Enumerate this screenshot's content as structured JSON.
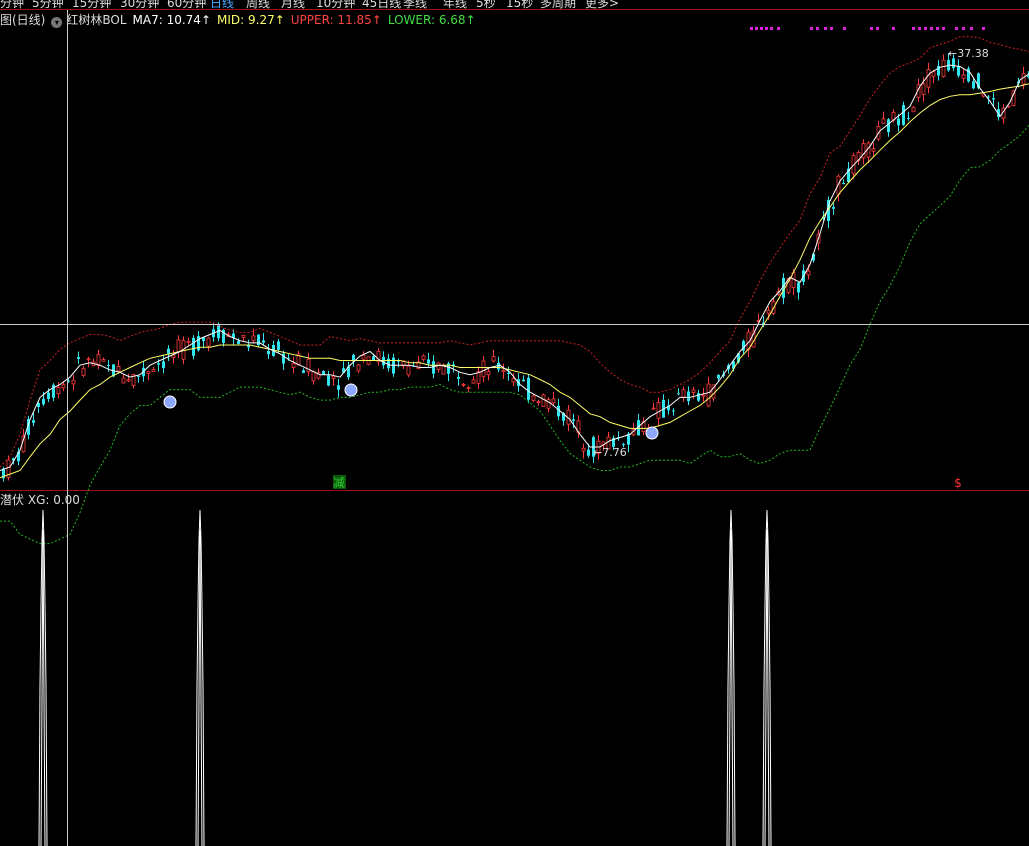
{
  "period_tabs": [
    {
      "label": "分钟",
      "active": false
    },
    {
      "label": "5分钟",
      "active": false
    },
    {
      "label": "15分钟",
      "active": false
    },
    {
      "label": "30分钟",
      "active": false
    },
    {
      "label": "60分钟",
      "active": false
    },
    {
      "label": "日线",
      "active": true
    },
    {
      "label": "周线",
      "active": false
    },
    {
      "label": "月线",
      "active": false
    },
    {
      "label": "10分钟",
      "active": false
    },
    {
      "label": "45日线",
      "active": false
    },
    {
      "label": "季线",
      "active": false
    },
    {
      "label": "年线",
      "active": false
    },
    {
      "label": "5秒",
      "active": false
    },
    {
      "label": "15秒",
      "active": false
    },
    {
      "label": "多周期",
      "active": false
    },
    {
      "label": "更多>",
      "active": false
    }
  ],
  "main_legend": {
    "panel_title": "图(日线)",
    "indicator_name": "红树林BOL",
    "ma7": "MA7: 10.74↑",
    "mid": "MID: 9.27↑",
    "upper": "UPPER: 11.85↑",
    "lower": "LOWER: 6.68↑",
    "colors": {
      "ma7": "#ffffff",
      "mid": "#ffff66",
      "upper": "#ff4444",
      "lower": "#44dd44"
    }
  },
  "sub_legend": {
    "name": "潜伏",
    "value": "XG: 0.00"
  },
  "chart_data": {
    "type": "line",
    "panels": [
      {
        "name": "price",
        "indicator": "红树林BOL",
        "x": [
          0,
          10,
          20,
          30,
          40,
          50,
          60,
          70,
          80,
          90,
          100,
          110,
          120,
          130,
          140,
          150,
          160,
          170,
          180,
          190,
          200,
          210,
          220,
          230,
          240,
          250,
          260,
          270,
          280,
          290,
          300,
          310,
          320,
          330,
          340,
          350,
          360,
          370,
          380,
          390,
          400,
          410,
          420,
          430,
          440,
          450,
          460,
          470,
          480,
          490,
          500,
          510,
          520,
          530,
          540,
          550,
          560,
          570,
          580,
          590,
          600,
          610,
          620,
          630,
          640,
          650,
          660,
          670,
          680,
          690,
          700,
          710,
          720,
          730,
          740,
          750,
          760,
          770,
          780,
          790,
          800,
          810,
          820,
          830,
          840,
          850,
          860,
          870,
          880,
          890,
          900,
          910,
          920,
          930,
          940,
          950,
          960,
          970,
          980,
          990,
          1000,
          1010,
          1020,
          1029
        ],
        "ma7": [
          7.2,
          7.3,
          7.8,
          8.8,
          9.6,
          9.9,
          10.1,
          10.4,
          10.9,
          11.0,
          10.9,
          10.7,
          10.6,
          10.4,
          10.5,
          10.9,
          11.1,
          11.3,
          11.5,
          11.8,
          12.1,
          12.3,
          12.5,
          12.2,
          12.0,
          11.9,
          11.9,
          11.6,
          11.4,
          11.1,
          10.9,
          10.7,
          10.5,
          10.5,
          10.4,
          10.9,
          11.3,
          11.5,
          11.1,
          10.9,
          10.9,
          10.9,
          10.8,
          10.8,
          10.9,
          10.8,
          10.6,
          10.5,
          10.6,
          10.8,
          10.9,
          10.6,
          10.1,
          9.8,
          9.6,
          9.4,
          9.1,
          8.8,
          8.3,
          7.9,
          7.9,
          8.1,
          8.2,
          8.3,
          8.6,
          8.9,
          9.1,
          9.3,
          9.6,
          9.6,
          9.7,
          9.8,
          10.3,
          10.9,
          11.5,
          12.0,
          13.0,
          14.0,
          14.6,
          15.4,
          15.1,
          16.2,
          18.3,
          20.8,
          22.5,
          23.6,
          24.6,
          25.8,
          27.4,
          28.3,
          29.2,
          30.2,
          32.7,
          34.4,
          35.2,
          35.5,
          35.3,
          34.5,
          32.4,
          30.8,
          29.0,
          30.7,
          33.5,
          34.3
        ],
        "mid": [
          7.0,
          7.1,
          7.2,
          7.6,
          8.0,
          8.3,
          8.8,
          9.1,
          9.5,
          9.9,
          10.1,
          10.4,
          10.6,
          10.8,
          11.0,
          11.2,
          11.3,
          11.4,
          11.5,
          11.6,
          11.7,
          11.7,
          11.8,
          11.8,
          11.8,
          11.8,
          11.7,
          11.6,
          11.5,
          11.4,
          11.3,
          11.2,
          11.2,
          11.2,
          11.1,
          11.1,
          11.1,
          11.1,
          11.1,
          11.1,
          11.1,
          11.0,
          11.0,
          10.9,
          10.9,
          10.9,
          10.8,
          10.8,
          10.8,
          10.8,
          10.8,
          10.7,
          10.6,
          10.5,
          10.3,
          10.1,
          9.8,
          9.6,
          9.3,
          9.0,
          8.9,
          8.7,
          8.6,
          8.5,
          8.5,
          8.5,
          8.6,
          8.7,
          8.9,
          9.1,
          9.3,
          9.6,
          10.0,
          10.5,
          11.2,
          11.7,
          12.5,
          13.3,
          14.3,
          15.3,
          16.5,
          18.0,
          19.2,
          20.3,
          21.5,
          22.5,
          23.5,
          24.4,
          25.4,
          26.4,
          27.3,
          28.4,
          29.4,
          30.3,
          31.0,
          31.4,
          31.6,
          31.6,
          31.8,
          32.0,
          32.3,
          32.5,
          32.7,
          33.0
        ],
        "upper": [
          7.3,
          7.6,
          8.3,
          9.5,
          10.7,
          11.1,
          11.6,
          11.9,
          12.1,
          12.3,
          12.3,
          12.2,
          12.0,
          12.2,
          12.4,
          12.5,
          12.6,
          12.8,
          12.9,
          12.9,
          12.9,
          12.9,
          12.7,
          12.5,
          12.4,
          12.4,
          12.6,
          12.4,
          12.2,
          12.0,
          11.8,
          11.8,
          11.8,
          12.2,
          12.1,
          12.0,
          12.1,
          12.0,
          11.9,
          11.9,
          11.9,
          11.9,
          11.9,
          11.9,
          11.9,
          12.0,
          11.9,
          11.8,
          11.9,
          12.0,
          12.0,
          12.0,
          12.0,
          12.0,
          12.0,
          12.0,
          12.0,
          11.9,
          11.8,
          11.5,
          11.0,
          10.6,
          10.3,
          10.1,
          10.0,
          9.8,
          9.8,
          9.9,
          10.1,
          10.3,
          10.6,
          11.0,
          11.5,
          12.0,
          13.1,
          14.0,
          15.2,
          16.3,
          17.3,
          18.3,
          19.3,
          21.4,
          22.8,
          25.1,
          25.8,
          27.4,
          29.1,
          31.1,
          32.8,
          34.4,
          35.3,
          35.8,
          36.5,
          38.0,
          38.5,
          39.0,
          39.7,
          39.7,
          39.5,
          38.8,
          38.5,
          38.0,
          37.8,
          37.4
        ],
        "lower": [
          5.9,
          5.9,
          5.6,
          5.5,
          5.4,
          5.4,
          5.5,
          5.6,
          6.1,
          6.8,
          7.3,
          7.8,
          8.6,
          9.0,
          9.3,
          9.3,
          9.6,
          9.9,
          9.9,
          9.9,
          9.6,
          9.6,
          9.6,
          9.8,
          10.0,
          10.0,
          10.0,
          9.9,
          9.8,
          9.7,
          9.8,
          9.6,
          9.5,
          9.5,
          9.6,
          9.6,
          9.7,
          9.8,
          9.8,
          9.9,
          9.9,
          10.0,
          10.0,
          10.0,
          10.1,
          9.9,
          9.8,
          9.8,
          9.8,
          9.8,
          9.8,
          9.8,
          9.7,
          9.4,
          9.1,
          8.6,
          8.1,
          7.7,
          7.5,
          7.3,
          7.2,
          7.2,
          7.3,
          7.3,
          7.4,
          7.5,
          7.5,
          7.5,
          7.5,
          7.4,
          7.6,
          7.8,
          7.6,
          7.6,
          7.7,
          7.5,
          7.4,
          7.5,
          7.7,
          7.8,
          7.8,
          7.8,
          8.5,
          9.2,
          10.0,
          10.9,
          11.6,
          12.8,
          14.0,
          14.9,
          16.1,
          17.7,
          19.0,
          19.7,
          20.4,
          21.2,
          22.6,
          23.7,
          23.8,
          24.4,
          25.4,
          26.1,
          26.9,
          28.0
        ],
        "annotations": [
          {
            "label": "37.38",
            "x": 948
          },
          {
            "label": "7.76",
            "x": 593
          }
        ],
        "signals": [
          {
            "label": "减",
            "x": 339,
            "color": "#33cc33"
          },
          {
            "label": "$",
            "x": 958,
            "color": "#ff3333"
          }
        ]
      },
      {
        "name": "潜伏",
        "series": [
          {
            "name": "XG",
            "x": [
              43,
              200,
              731,
              767
            ],
            "values": [
              1,
              1,
              1,
              1
            ]
          }
        ]
      }
    ]
  }
}
